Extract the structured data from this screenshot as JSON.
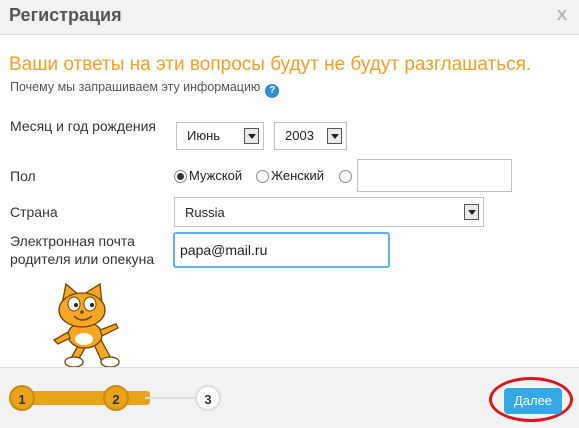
{
  "dialog": {
    "title": "Регистрация",
    "close_label": "X"
  },
  "intro": {
    "headline": "Ваши ответы на эти вопросы будут не будут разглашаться.",
    "why_text": "Почему мы запрашиваем эту информацию",
    "help_icon": "?"
  },
  "form": {
    "birth_label": "Месяц и год рождения",
    "birth_month": "Июнь",
    "birth_year": "2003",
    "gender_label": "Пол",
    "gender_male": "Мужской",
    "gender_female": "Женский",
    "gender_selected": "male",
    "country_label": "Страна",
    "country_value": "Russia",
    "email_label": "Электронная почта родителя или опекуна",
    "email_value": "papa@mail.ru"
  },
  "steps": {
    "items": [
      "1",
      "2",
      "3"
    ],
    "current": 2
  },
  "footer": {
    "next_label": "Далее"
  },
  "colors": {
    "accent_orange": "#f0a028",
    "step_orange": "#e8a318",
    "button_blue": "#34a7e6",
    "highlight_red": "#d8181f"
  }
}
